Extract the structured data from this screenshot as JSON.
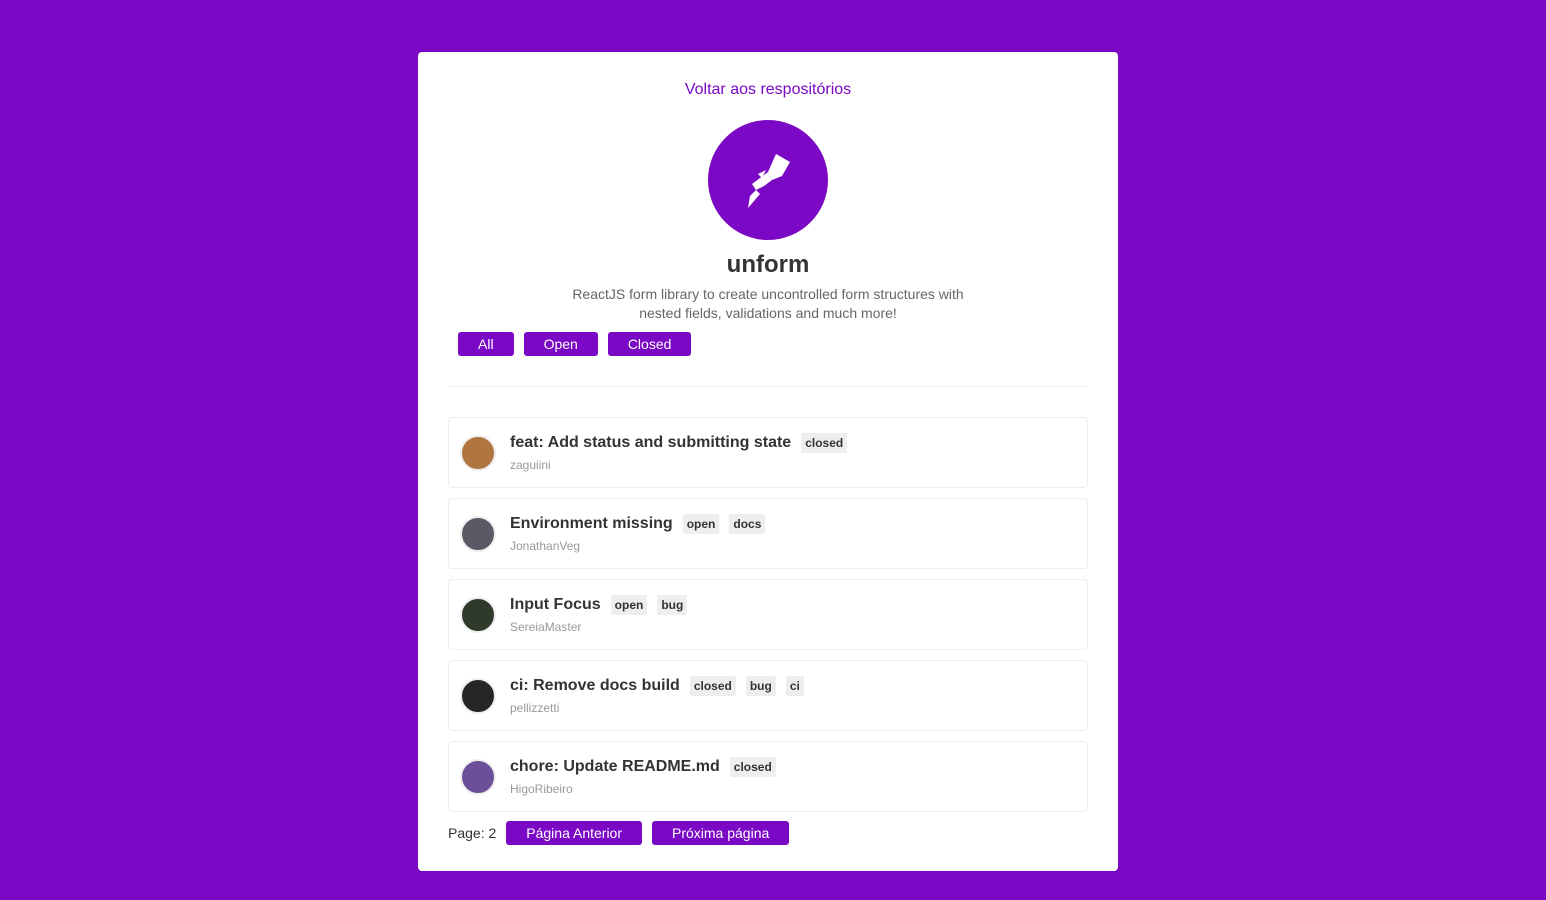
{
  "navigation": {
    "back_label": "Voltar aos respositórios"
  },
  "repository": {
    "name": "unform",
    "description": "ReactJS form library to create uncontrolled form structures with nested fields, validations and much more!",
    "avatar_icon": "unform-logo-icon",
    "accent_color": "#7a08c4"
  },
  "filters": [
    {
      "label": "All"
    },
    {
      "label": "Open"
    },
    {
      "label": "Closed"
    }
  ],
  "issues": [
    {
      "title": "feat: Add status and submitting state",
      "author": "zaguiini",
      "labels": [
        "closed"
      ],
      "avatar_color": "#b0763f"
    },
    {
      "title": "Environment missing",
      "author": "JonathanVeg",
      "labels": [
        "open",
        "docs"
      ],
      "avatar_color": "#5a5a66"
    },
    {
      "title": "Input Focus",
      "author": "SereiaMaster",
      "labels": [
        "open",
        "bug"
      ],
      "avatar_color": "#2f3a2a"
    },
    {
      "title": "ci: Remove docs build",
      "author": "pellizzetti",
      "labels": [
        "closed",
        "bug",
        "ci"
      ],
      "avatar_color": "#262626"
    },
    {
      "title": "chore: Update README.md",
      "author": "HigoRibeiro",
      "labels": [
        "closed"
      ],
      "avatar_color": "#6b4f98"
    }
  ],
  "pagination": {
    "page_text": "Page: 2",
    "prev_label": "Página Anterior",
    "next_label": "Próxima página"
  }
}
